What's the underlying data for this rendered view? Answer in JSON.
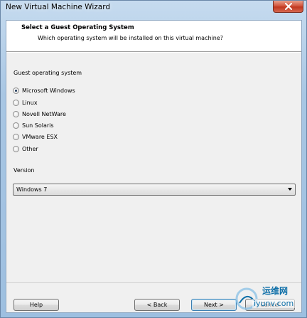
{
  "window": {
    "title": "New Virtual Machine Wizard"
  },
  "header": {
    "title": "Select a Guest Operating System",
    "subtitle": "Which operating system will be installed on this virtual machine?"
  },
  "guest_os": {
    "label": "Guest operating system",
    "options": [
      {
        "label": "Microsoft Windows",
        "checked": true
      },
      {
        "label": "Linux",
        "checked": false
      },
      {
        "label": "Novell NetWare",
        "checked": false
      },
      {
        "label": "Sun Solaris",
        "checked": false
      },
      {
        "label": "VMware ESX",
        "checked": false
      },
      {
        "label": "Other",
        "checked": false
      }
    ]
  },
  "version": {
    "label": "Version",
    "selected": "Windows 7"
  },
  "buttons": {
    "help": "Help",
    "back": "< Back",
    "next": "Next >",
    "cancel": "Cancel"
  },
  "watermark": {
    "text1": "运维网",
    "text2": "iyunv.com"
  },
  "colors": {
    "close_button": "#c94a32",
    "frame": "#a8c6e3",
    "watermark": "#0e6fa8"
  }
}
